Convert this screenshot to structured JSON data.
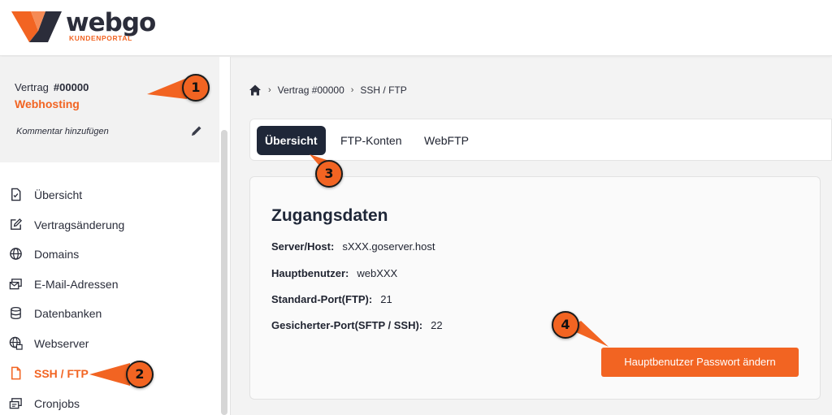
{
  "brand": {
    "name": "webgo",
    "subtitle": "KUNDENPORTAL",
    "accent": "#f26422",
    "dark": "#1f2738"
  },
  "contract": {
    "label": "Vertrag",
    "number": "#00000",
    "type": "Webhosting",
    "comment_link": "Kommentar hinzufügen",
    "edit_icon": "pencil-icon"
  },
  "sidebar": {
    "items": [
      {
        "label": "Übersicht",
        "icon": "document-icon"
      },
      {
        "label": "Vertragsänderung",
        "icon": "edit-icon"
      },
      {
        "label": "Domains",
        "icon": "globe-icon"
      },
      {
        "label": "E-Mail-Adressen",
        "icon": "mail-icon"
      },
      {
        "label": "Datenbanken",
        "icon": "database-icon"
      },
      {
        "label": "Webserver",
        "icon": "server-globe-icon"
      },
      {
        "label": "SSH / FTP",
        "icon": "file-icon",
        "active": true
      },
      {
        "label": "Cronjobs",
        "icon": "cron-icon"
      }
    ]
  },
  "breadcrumb": {
    "home_icon": "home-icon",
    "items": [
      "Vertrag #00000",
      "SSH / FTP"
    ]
  },
  "tabs": [
    {
      "label": "Übersicht",
      "active": true
    },
    {
      "label": "FTP-Konten"
    },
    {
      "label": "WebFTP"
    }
  ],
  "access": {
    "title": "Zugangsdaten",
    "rows": [
      {
        "key": "Server/Host:",
        "value": "sXXX.goserver.host"
      },
      {
        "key": "Hauptbenutzer:",
        "value": "webXXX"
      },
      {
        "key": "Standard-Port(FTP):",
        "value": "21"
      },
      {
        "key": "Gesicherter-Port(SFTP / SSH):",
        "value": "22"
      }
    ],
    "button_label": "Hauptbenutzer Passwort ändern"
  },
  "callouts": [
    "1",
    "2",
    "3",
    "4"
  ]
}
